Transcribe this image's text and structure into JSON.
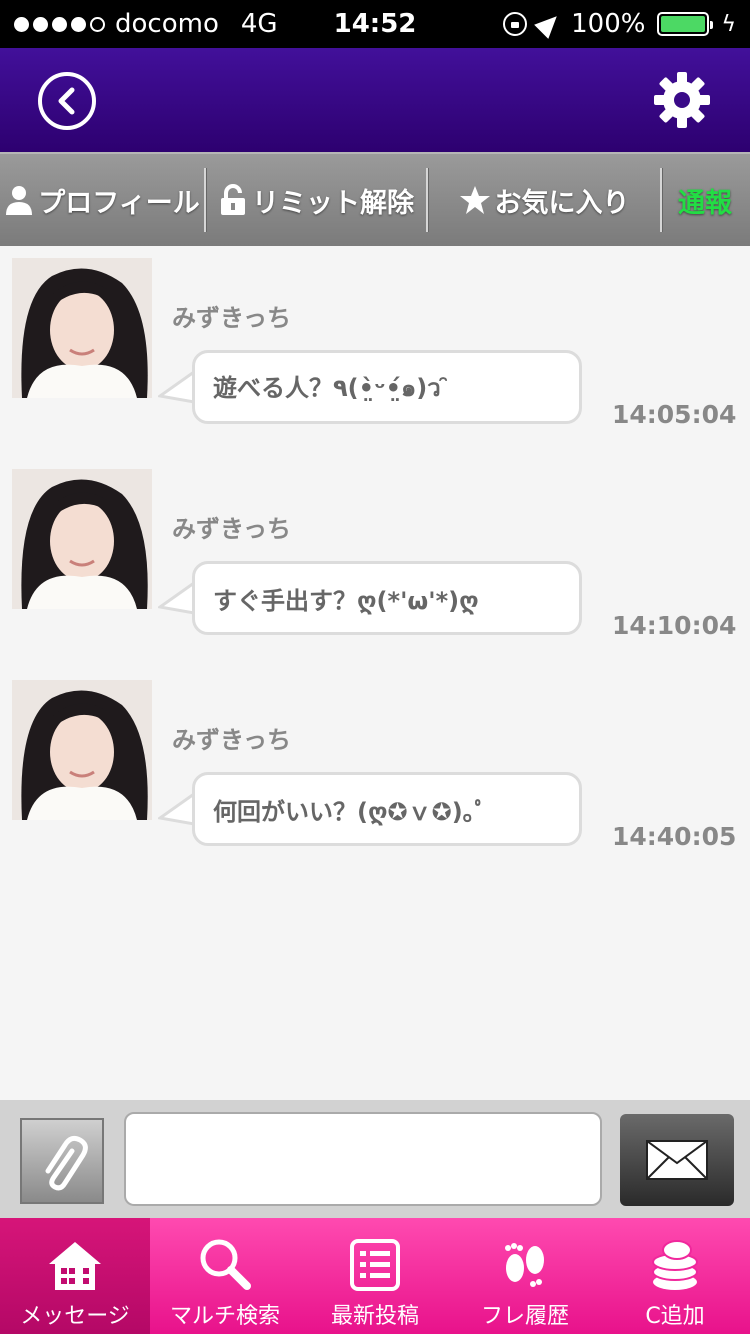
{
  "status_bar": {
    "carrier": "docomo",
    "network": "4G",
    "time": "14:52",
    "battery": "100%",
    "battery_level": 1.0,
    "battery_color": "#4cd964"
  },
  "header": {
    "back_icon": "back-chevron-circle-icon",
    "settings_icon": "gear-icon",
    "background": "#3a0a88"
  },
  "toolbar": {
    "profile": "プロフィール",
    "unlock": "リミット解除",
    "favorite": "お気に入り",
    "report": "通報"
  },
  "messages": [
    {
      "sender": "みずきっち",
      "text": "遊べる人？٩(•̤̀ᵕ•̤́๑)ว ̑̑",
      "time": "14:05:04"
    },
    {
      "sender": "みずきっち",
      "text": "すぐ手出す？ღ(*'ω'*)ღ",
      "time": "14:10:04"
    },
    {
      "sender": "みずきっち",
      "text": "何回がいい？(ღ✪ｖ✪)｡ﾟ",
      "time": "14:40:05"
    }
  ],
  "input": {
    "value": "",
    "placeholder": ""
  },
  "bottom_nav": {
    "items": [
      {
        "label": "メッセージ",
        "icon": "house-icon"
      },
      {
        "label": "マルチ検索",
        "icon": "magnifier-icon"
      },
      {
        "label": "最新投稿",
        "icon": "list-icon"
      },
      {
        "label": "フレ履歴",
        "icon": "footprints-icon"
      },
      {
        "label": "C追加",
        "icon": "coins-icon"
      }
    ],
    "colors": {
      "active": "#c20c70",
      "inactive": "#f0289c"
    }
  }
}
